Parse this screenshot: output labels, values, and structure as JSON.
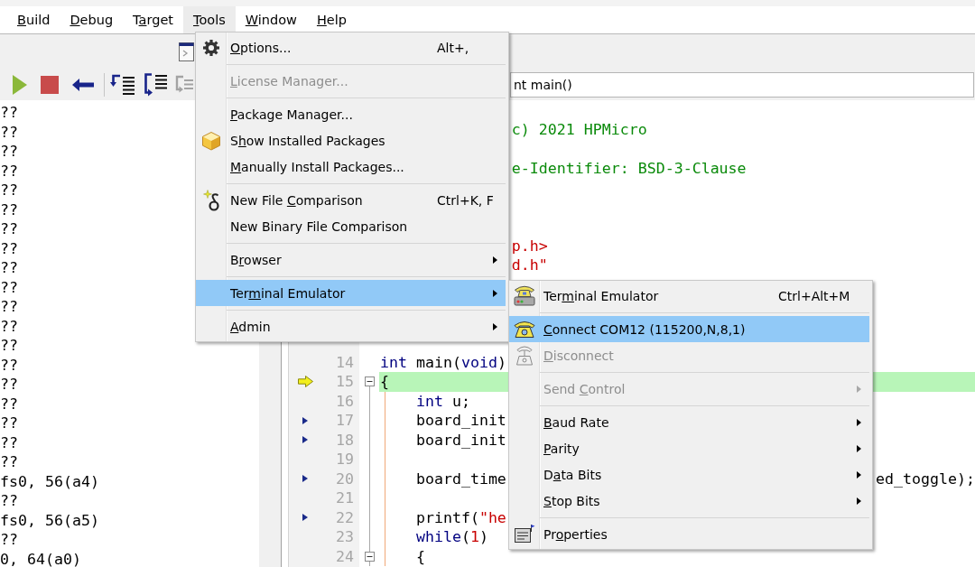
{
  "menubar": [
    {
      "label": [
        {
          "text": "B",
          "underlined": true
        },
        {
          "text": "uild",
          "underlined": false
        }
      ],
      "selected": false
    },
    {
      "label": [
        {
          "text": "D",
          "underlined": true
        },
        {
          "text": "ebug",
          "underlined": false
        }
      ],
      "selected": false
    },
    {
      "label": [
        {
          "text": "T",
          "underlined": false
        },
        {
          "text": "a",
          "underlined": true
        },
        {
          "text": "rget",
          "underlined": false
        }
      ],
      "selected": false
    },
    {
      "label": [
        {
          "text": "T",
          "underlined": true
        },
        {
          "text": "ools",
          "underlined": false
        }
      ],
      "selected": true
    },
    {
      "label": [
        {
          "text": "W",
          "underlined": true
        },
        {
          "text": "indow",
          "underlined": false
        }
      ],
      "selected": false
    },
    {
      "label": [
        {
          "text": "H",
          "underlined": true
        },
        {
          "text": "elp",
          "underlined": false
        }
      ],
      "selected": false
    }
  ],
  "toolbar": {
    "top_row": [
      {
        "kind": "window",
        "disabled": false
      }
    ],
    "groups": [
      {
        "buttons": [
          {
            "kind": "run",
            "disabled": false
          },
          {
            "kind": "stop",
            "disabled": false
          },
          {
            "kind": "back",
            "disabled": false
          }
        ]
      },
      {
        "buttons": [
          {
            "kind": "step_into",
            "disabled": false
          },
          {
            "kind": "step_over",
            "disabled": false
          },
          {
            "kind": "step_out",
            "disabled": true
          }
        ]
      }
    ],
    "function_selector": {
      "value": "nt main()"
    }
  },
  "left_pane": {
    "lines": [
      "??",
      "??",
      "??",
      "??",
      "??",
      "??",
      "??",
      "??",
      "??",
      "??",
      "??",
      "??",
      "??",
      "??",
      "??",
      "??",
      "??",
      "??",
      "??",
      "fs0, 56(a4)",
      "??",
      "fs0, 56(a5)",
      "??",
      "0, 64(a0)"
    ]
  },
  "editor": {
    "lines": [
      {
        "highlighted": false
      },
      {
        "highlighted": false,
        "indented": false,
        "tokens": [
          {
            "kind": "comment",
            "text": "c) 2021 HPMicro"
          }
        ]
      },
      {
        "highlighted": false
      },
      {
        "highlighted": false,
        "indented": false,
        "tokens": [
          {
            "kind": "comment",
            "text": "e-Identifier: BSD-3-Clause"
          }
        ]
      },
      {
        "highlighted": false
      },
      {
        "highlighted": false
      },
      {
        "highlighted": false
      },
      {
        "highlighted": false,
        "indented": false,
        "tokens": [
          {
            "kind": "string",
            "text": "p.h>"
          }
        ]
      },
      {
        "highlighted": false,
        "indented": false,
        "tokens": [
          {
            "kind": "string",
            "text": "d.h\""
          }
        ]
      },
      {
        "highlighted": false
      },
      {
        "highlighted": false
      },
      {
        "highlighted": false
      },
      {
        "highlighted": false
      },
      {
        "number": "14",
        "highlighted": false,
        "indented": false,
        "tokens": [
          {
            "kind": "keyword",
            "text": "int"
          },
          {
            "kind": "plain",
            "text": " main("
          },
          {
            "kind": "keyword",
            "text": "void"
          },
          {
            "kind": "plain",
            "text": ")"
          }
        ]
      },
      {
        "number": "15",
        "marker": {
          "kind": "execution"
        },
        "fold": {
          "expanded": true
        },
        "highlighted": true,
        "indented": false,
        "tokens": [
          {
            "kind": "plain",
            "text": "{"
          }
        ]
      },
      {
        "number": "16",
        "highlighted": false,
        "indented": true,
        "tokens": [
          {
            "kind": "keyword",
            "text": "int"
          },
          {
            "kind": "plain",
            "text": " u;"
          }
        ]
      },
      {
        "number": "17",
        "marker": {
          "kind": "code"
        },
        "highlighted": false,
        "indented": true,
        "tokens": [
          {
            "kind": "plain",
            "text": "board_init"
          }
        ]
      },
      {
        "number": "18",
        "marker": {
          "kind": "code"
        },
        "highlighted": false,
        "indented": true,
        "tokens": [
          {
            "kind": "plain",
            "text": "board_init"
          }
        ]
      },
      {
        "number": "19",
        "highlighted": false
      },
      {
        "number": "20",
        "marker": {
          "kind": "code"
        },
        "highlighted": false,
        "indented": true,
        "tokens": [
          {
            "kind": "plain",
            "text": "board_time"
          }
        ],
        "tail_tokens": [
          {
            "kind": "plain",
            "text": "ed_toggle);"
          }
        ]
      },
      {
        "number": "21",
        "highlighted": false
      },
      {
        "number": "22",
        "marker": {
          "kind": "code"
        },
        "highlighted": false,
        "indented": true,
        "tokens": [
          {
            "kind": "plain",
            "text": "printf("
          },
          {
            "kind": "string",
            "text": "\"he"
          }
        ]
      },
      {
        "number": "23",
        "highlighted": false,
        "indented": true,
        "tokens": [
          {
            "kind": "keyword",
            "text": "while"
          },
          {
            "kind": "plain",
            "text": "("
          },
          {
            "kind": "number",
            "text": "1"
          },
          {
            "kind": "plain",
            "text": ")"
          }
        ]
      },
      {
        "number": "24",
        "fold": {
          "expanded": true
        },
        "highlighted": false,
        "indented": true,
        "tokens": [
          {
            "kind": "plain",
            "text": "{"
          }
        ]
      }
    ]
  },
  "tools_menu": {
    "groups": [
      {
        "items": [
          {
            "label": [
              {
                "text": "O",
                "underlined": true
              },
              {
                "text": "ptions...",
                "underlined": false
              }
            ],
            "shortcut": "Alt+,",
            "disabled": false,
            "selected": false,
            "submenu": false
          }
        ]
      },
      {
        "items": [
          {
            "label": [
              {
                "text": "L",
                "underlined": true
              },
              {
                "text": "icense Manager...",
                "underlined": false
              }
            ],
            "disabled": true,
            "selected": false,
            "submenu": false
          }
        ]
      },
      {
        "items": [
          {
            "label": [
              {
                "text": "P",
                "underlined": true
              },
              {
                "text": "ackage Manager...",
                "underlined": false
              }
            ],
            "disabled": false,
            "selected": false,
            "submenu": false
          },
          {
            "label": [
              {
                "text": "S",
                "underlined": false
              },
              {
                "text": "h",
                "underlined": true
              },
              {
                "text": "ow Installed Packages",
                "underlined": false
              }
            ],
            "disabled": false,
            "selected": false,
            "submenu": false
          },
          {
            "label": [
              {
                "text": "M",
                "underlined": true
              },
              {
                "text": "anually Install Packages...",
                "underlined": false
              }
            ],
            "disabled": false,
            "selected": false,
            "submenu": false
          }
        ]
      },
      {
        "items": [
          {
            "label": [
              {
                "text": "New File ",
                "underlined": false
              },
              {
                "text": "C",
                "underlined": true
              },
              {
                "text": "omparison",
                "underlined": false
              }
            ],
            "shortcut": "Ctrl+K, F",
            "disabled": false,
            "selected": false,
            "submenu": false
          },
          {
            "label": [
              {
                "text": "New Binary File Comparison",
                "underlined": false
              }
            ],
            "disabled": false,
            "selected": false,
            "submenu": false
          }
        ]
      },
      {
        "items": [
          {
            "label": [
              {
                "text": "B",
                "underlined": false
              },
              {
                "text": "r",
                "underlined": true
              },
              {
                "text": "owser",
                "underlined": false
              }
            ],
            "disabled": false,
            "selected": false,
            "submenu": true
          }
        ]
      },
      {
        "items": [
          {
            "label": [
              {
                "text": "Ter",
                "underlined": false
              },
              {
                "text": "m",
                "underlined": true
              },
              {
                "text": "inal Emulator",
                "underlined": false
              }
            ],
            "disabled": false,
            "selected": true,
            "submenu": true
          }
        ]
      },
      {
        "items": [
          {
            "label": [
              {
                "text": "A",
                "underlined": true
              },
              {
                "text": "dmin",
                "underlined": false
              }
            ],
            "disabled": false,
            "selected": false,
            "submenu": true
          }
        ]
      }
    ]
  },
  "terminal_submenu": {
    "groups": [
      {
        "items": [
          {
            "label": [
              {
                "text": "Ter",
                "underlined": false
              },
              {
                "text": "m",
                "underlined": true
              },
              {
                "text": "inal Emulator",
                "underlined": false
              }
            ],
            "shortcut": "Ctrl+Alt+M",
            "disabled": false,
            "selected": false,
            "submenu": false
          }
        ]
      },
      {
        "items": [
          {
            "label": [
              {
                "text": "C",
                "underlined": true
              },
              {
                "text": "onnect COM12 (115200,N,8,1)",
                "underlined": false
              }
            ],
            "disabled": false,
            "selected": true,
            "submenu": false
          },
          {
            "label": [
              {
                "text": "D",
                "underlined": true
              },
              {
                "text": "isconnect",
                "underlined": false
              }
            ],
            "disabled": true,
            "selected": false,
            "submenu": false
          }
        ]
      },
      {
        "items": [
          {
            "label": [
              {
                "text": "Send ",
                "underlined": false
              },
              {
                "text": "C",
                "underlined": true
              },
              {
                "text": "ontrol",
                "underlined": false
              }
            ],
            "disabled": true,
            "selected": false,
            "submenu": true
          }
        ]
      },
      {
        "items": [
          {
            "label": [
              {
                "text": "B",
                "underlined": true
              },
              {
                "text": "aud Rate",
                "underlined": false
              }
            ],
            "disabled": false,
            "selected": false,
            "submenu": true
          },
          {
            "label": [
              {
                "text": "P",
                "underlined": true
              },
              {
                "text": "arity",
                "underlined": false
              }
            ],
            "disabled": false,
            "selected": false,
            "submenu": true
          },
          {
            "label": [
              {
                "text": "D",
                "underlined": false
              },
              {
                "text": "a",
                "underlined": true
              },
              {
                "text": "ta Bits",
                "underlined": false
              }
            ],
            "disabled": false,
            "selected": false,
            "submenu": true
          },
          {
            "label": [
              {
                "text": "S",
                "underlined": true
              },
              {
                "text": "top Bits",
                "underlined": false
              }
            ],
            "disabled": false,
            "selected": false,
            "submenu": true
          }
        ]
      },
      {
        "items": [
          {
            "label": [
              {
                "text": "Pr",
                "underlined": false
              },
              {
                "text": "o",
                "underlined": true
              },
              {
                "text": "perties",
                "underlined": false
              }
            ],
            "disabled": false,
            "selected": false,
            "submenu": false
          }
        ]
      }
    ]
  }
}
